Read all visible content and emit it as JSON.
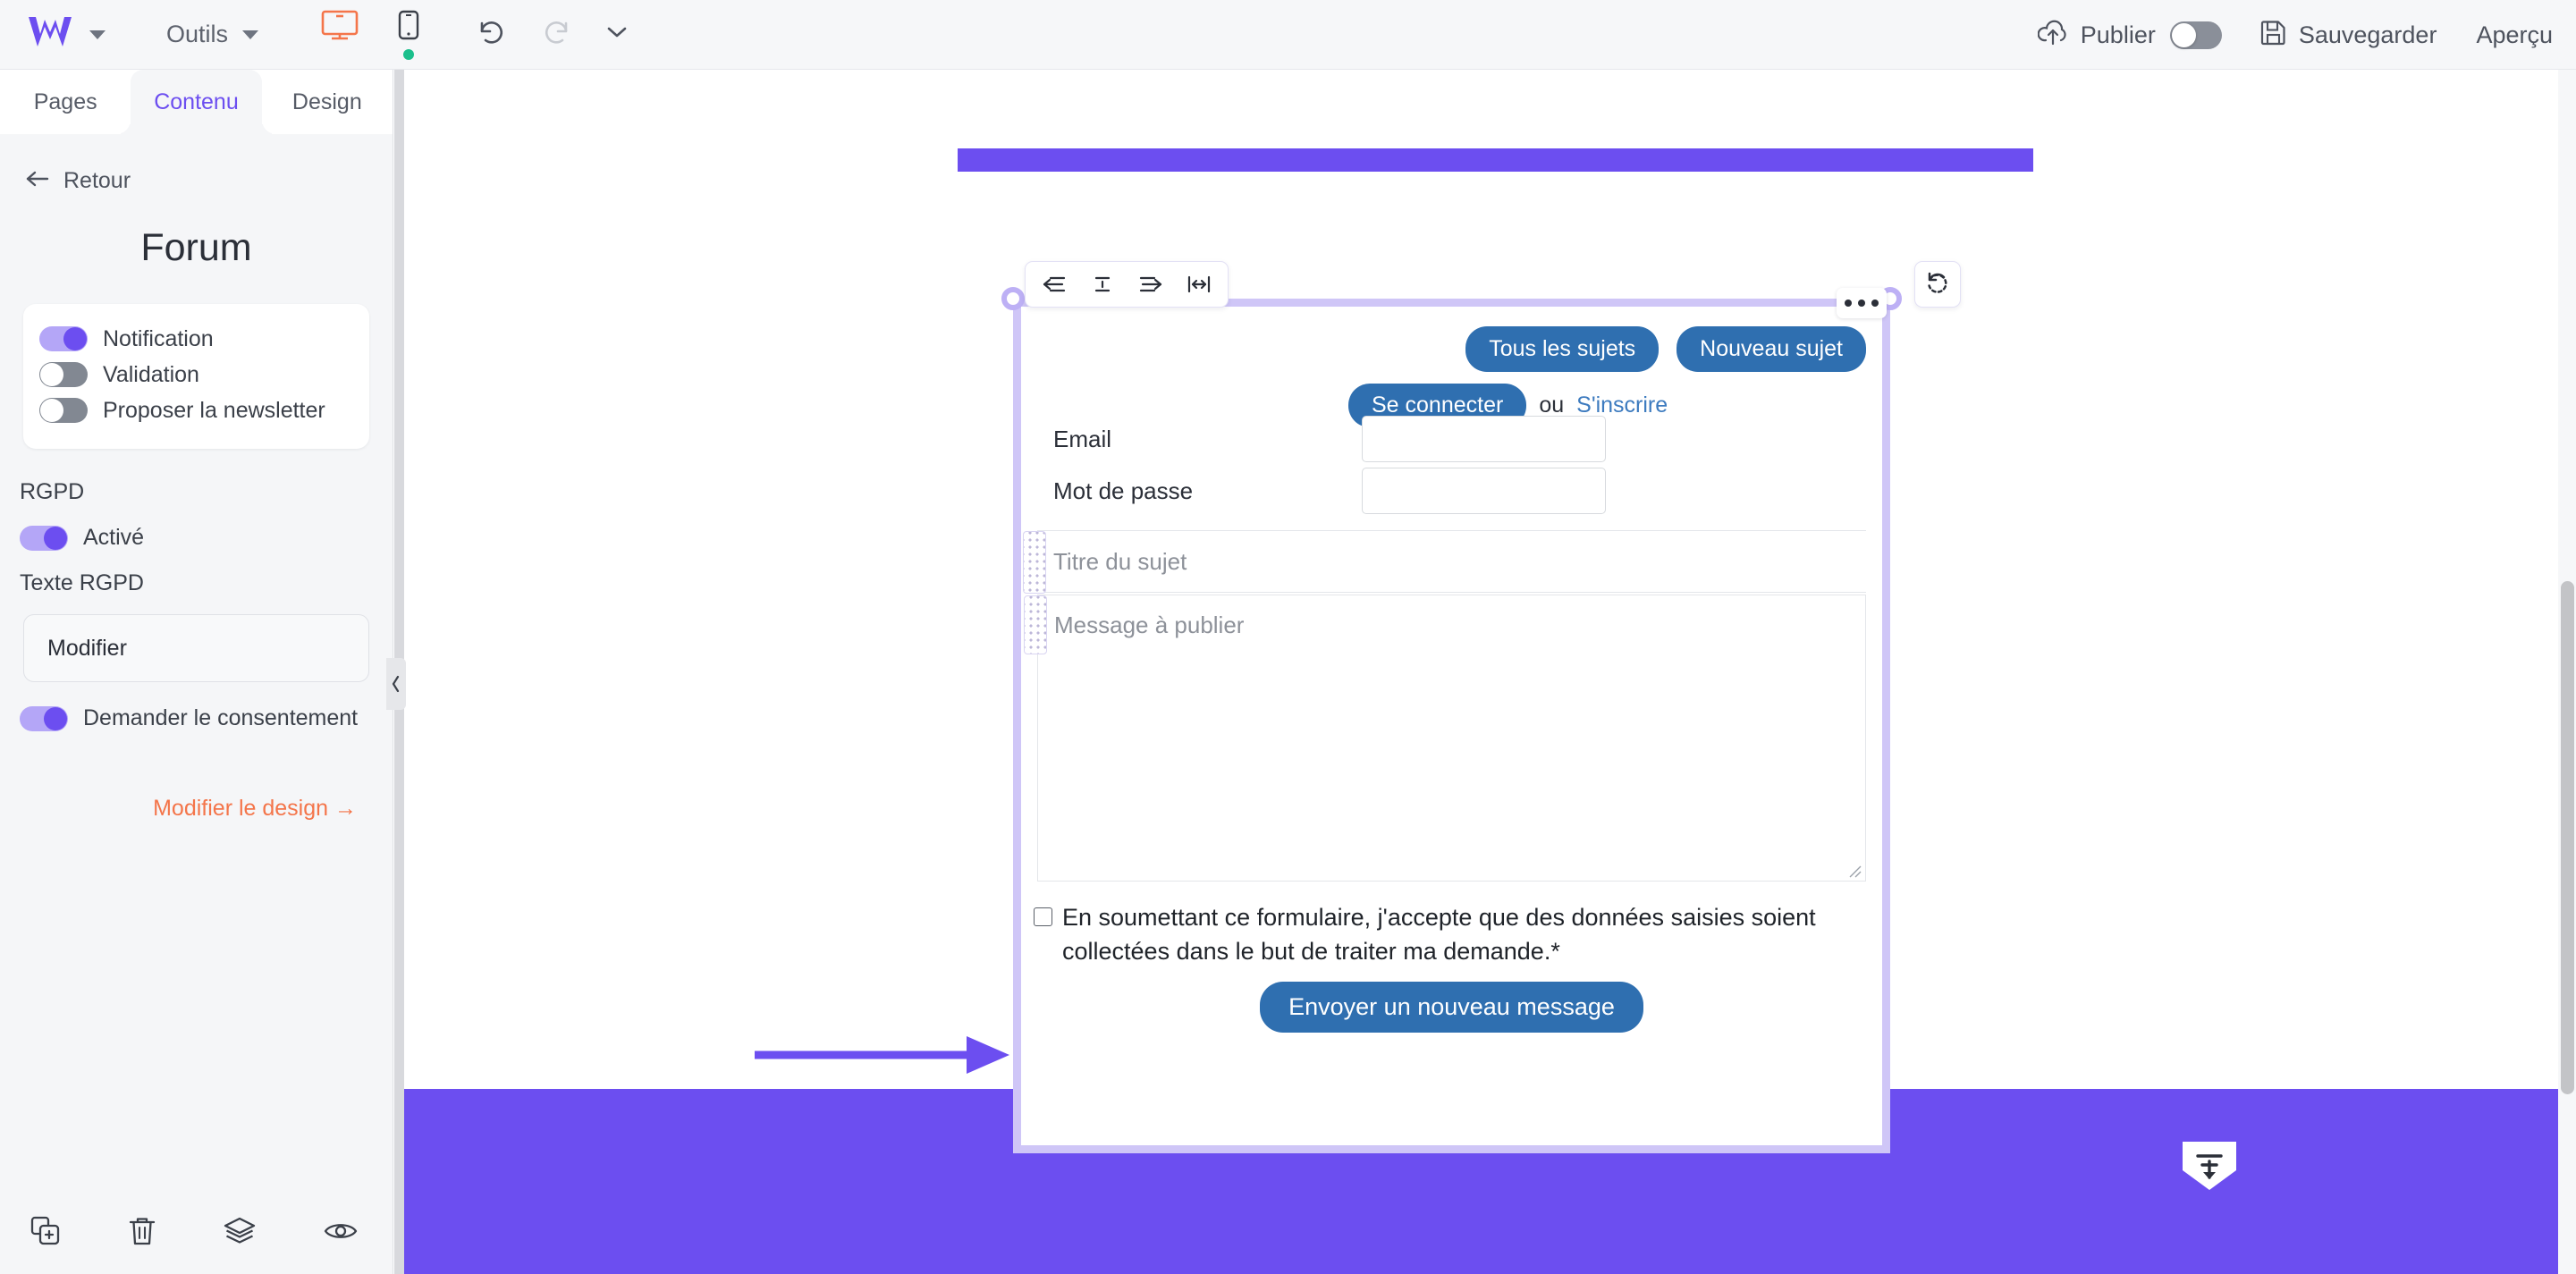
{
  "topbar": {
    "logo": "webself-logo",
    "tools_label": "Outils",
    "desktop_icon": "desktop-monitor-icon",
    "mobile_icon": "mobile-phone-icon",
    "undo_icon": "undo-icon",
    "redo_icon": "redo-icon",
    "more_icon": "chevron-down-icon",
    "publish_label": "Publier",
    "publish_toggle_state": "off",
    "save_label": "Sauvegarder",
    "preview_label": "Aperçu"
  },
  "sidebar": {
    "tabs": [
      {
        "label": "Pages",
        "active": false
      },
      {
        "label": "Contenu",
        "active": true
      },
      {
        "label": "Design",
        "active": false
      }
    ],
    "back_label": "Retour",
    "title": "Forum",
    "options": [
      {
        "label": "Notification",
        "state": "on"
      },
      {
        "label": "Validation",
        "state": "off"
      },
      {
        "label": "Proposer la newsletter",
        "state": "off"
      }
    ],
    "rgpd_section_label": "RGPD",
    "rgpd_enabled": {
      "label": "Activé",
      "state": "on"
    },
    "rgpd_text_label": "Texte RGPD",
    "rgpd_modify_value": "Modifier",
    "consent": {
      "label": "Demander le consentement",
      "state": "on"
    },
    "design_link": "Modifier le design →",
    "bottom_icons": [
      "duplicate-icon",
      "trash-icon",
      "layers-icon",
      "eye-icon"
    ]
  },
  "canvas": {
    "align_toolbar": [
      "align-left-icon",
      "align-center-icon",
      "align-right-icon",
      "fit-width-icon"
    ],
    "reset_icon": "reset-rotate-icon",
    "more_options": "ellipsis-icon",
    "insert_below_icon": "insert-below-icon",
    "banner_color": "#6c4ef0",
    "footer_color": "#6c4ef0",
    "selection_color": "#cfc6f7",
    "annotation_arrow_color": "#6c4ef0"
  },
  "form": {
    "all_topics_label": "Tous les sujets",
    "new_topic_label": "Nouveau sujet",
    "login_button_label": "Se connecter",
    "or_label": "ou",
    "signup_link_label": "S'inscrire",
    "email_label": "Email",
    "email_value": "",
    "password_label": "Mot de passe",
    "password_value": "",
    "subject_placeholder": "Titre du sujet",
    "subject_value": "",
    "message_placeholder": "Message à publier",
    "message_value": "",
    "gdpr_text": "En soumettant ce formulaire, j'accepte que des données saisies soient collectées dans le but de traiter ma demande.*",
    "gdpr_checked": false,
    "submit_label": "Envoyer un nouveau message",
    "button_color": "#2f6fb0",
    "link_color": "#3d7bbf"
  }
}
